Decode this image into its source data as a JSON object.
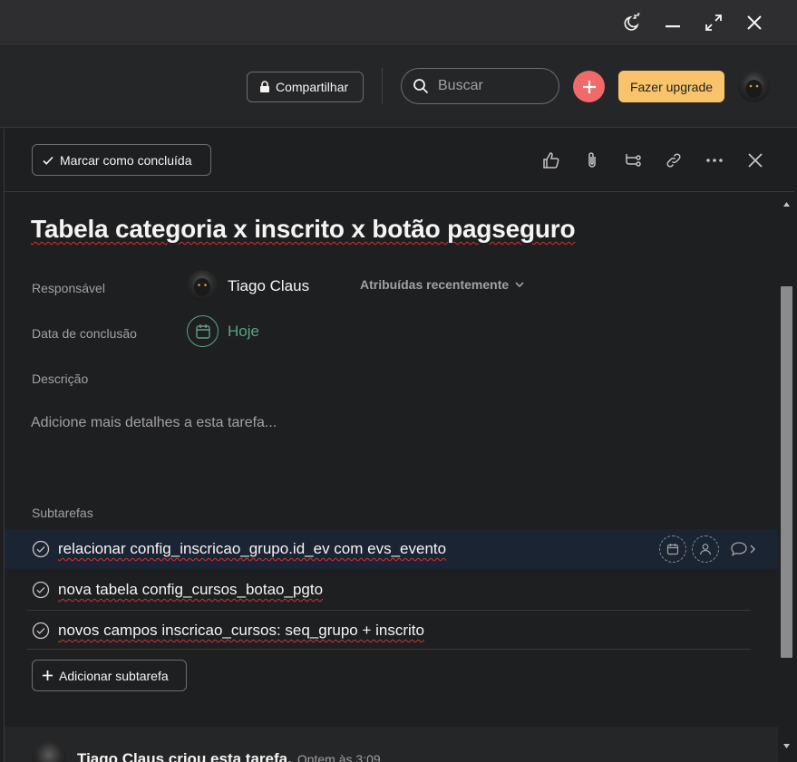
{
  "window": {
    "controls": [
      "sleep-icon",
      "minimize-icon",
      "maximize-icon",
      "close-icon"
    ]
  },
  "topbar": {
    "share_label": "Compartilhar",
    "search_placeholder": "Buscar",
    "upgrade_label": "Fazer upgrade",
    "colors": {
      "plus": "#f06a6a",
      "upgrade": "#f8c36a"
    }
  },
  "task": {
    "complete_label": "Marcar como concluída",
    "title": "Tabela categoria x inscrito x botão pagseguro",
    "fields": {
      "assignee_label": "Responsável",
      "assignee_name": "Tiago Claus",
      "recent_label": "Atribuídas recentemente",
      "due_label": "Data de conclusão",
      "due_value": "Hoje",
      "description_label": "Descrição",
      "description_placeholder": "Adicione mais detalhes a esta tarefa..."
    },
    "subtasks_label": "Subtarefas",
    "subtasks": [
      {
        "text": "relacionar config_inscricao_grupo.id_ev com evs_evento"
      },
      {
        "text": "nova tabela config_cursos_botao_pgto"
      },
      {
        "text": "novos campos inscricao_cursos: seq_grupo + inscrito"
      }
    ],
    "add_subtask_label": "Adicionar subtarefa",
    "activity": {
      "text": "Tiago Claus criou esta tarefa.",
      "time": "Ontem às 3:09"
    }
  }
}
